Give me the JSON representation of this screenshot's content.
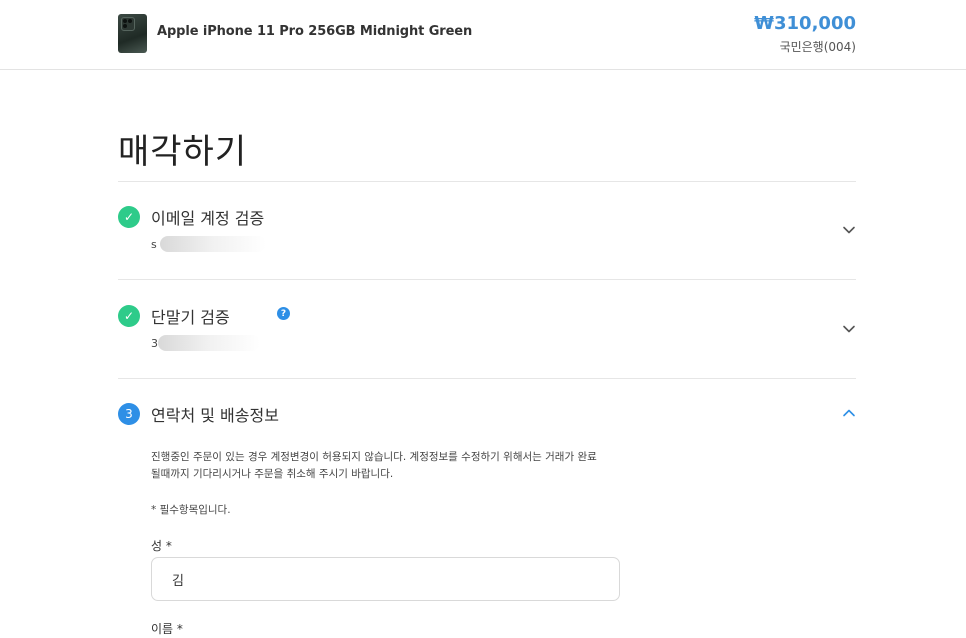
{
  "header": {
    "product_name": "Apple iPhone 11 Pro 256GB Midnight Green",
    "price": "₩310,000",
    "bank": "국민은행(004)",
    "thumbnail_icon": "phone-thumbnail"
  },
  "page": {
    "title": "매각하기"
  },
  "steps": [
    {
      "badge": "✓",
      "title": "이메일 계정 검증",
      "sub": "s",
      "state": "done",
      "expand_icon": "chevron-down-icon"
    },
    {
      "badge": "✓",
      "title": "단말기 검증",
      "sub": "3",
      "state": "done",
      "help": "?",
      "expand_icon": "chevron-down-icon"
    },
    {
      "badge": "3",
      "title": "연락처 및 배송정보",
      "state": "active",
      "expand_icon": "chevron-up-icon"
    }
  ],
  "contact": {
    "notice_line1": "진행중인 주문이 있는 경우 계정변경이 허용되지 않습니다. 계정정보를 수정하기 위해서는 거래가 완료",
    "notice_line2": "될때까지 기다리시거나 주문을 취소해 주시기 바랍니다.",
    "required_note": "* 필수항목입니다.",
    "last_name_label": "성 *",
    "last_name_value": "김",
    "first_name_label": "이름 *"
  },
  "colors": {
    "accent": "#3f8fd6",
    "done": "#2ecb8a",
    "active": "#2e8fe6"
  }
}
